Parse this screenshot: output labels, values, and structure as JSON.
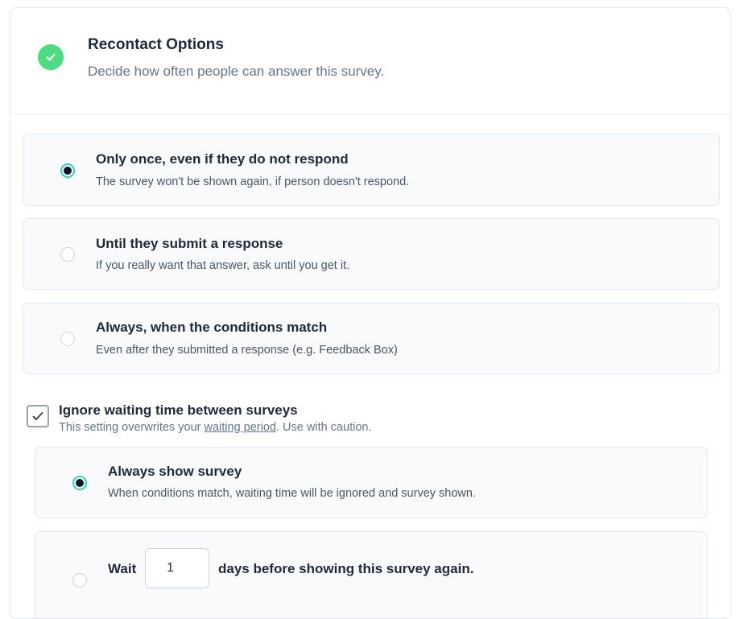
{
  "header": {
    "title": "Recontact Options",
    "subtitle": "Decide how often people can answer this survey."
  },
  "options": [
    {
      "title": "Only once, even if they do not respond",
      "description": "The survey won't be shown again, if person doesn't respond.",
      "selected": true
    },
    {
      "title": "Until they submit a response",
      "description": "If you really want that answer, ask until you get it.",
      "selected": false
    },
    {
      "title": "Always, when the conditions match",
      "description": "Even after they submitted a response (e.g. Feedback Box)",
      "selected": false
    }
  ],
  "ignore_waiting": {
    "label": "Ignore waiting time between surveys",
    "desc_prefix": "This setting overwrites your ",
    "link_text": "waiting period",
    "desc_suffix": ". Use with caution.",
    "checked": true
  },
  "sub_options": {
    "always_show": {
      "title": "Always show survey",
      "description": "When conditions match, waiting time will be ignored and survey shown.",
      "selected": true
    },
    "wait_days": {
      "prefix": "Wait",
      "value": "1",
      "suffix": "days before showing this survey again.",
      "selected": false
    }
  },
  "colors": {
    "accent": "#4ade80",
    "radio_ring": "#2dd4bf",
    "card_bg": "#f8fafc",
    "border": "#e2e8f0"
  }
}
